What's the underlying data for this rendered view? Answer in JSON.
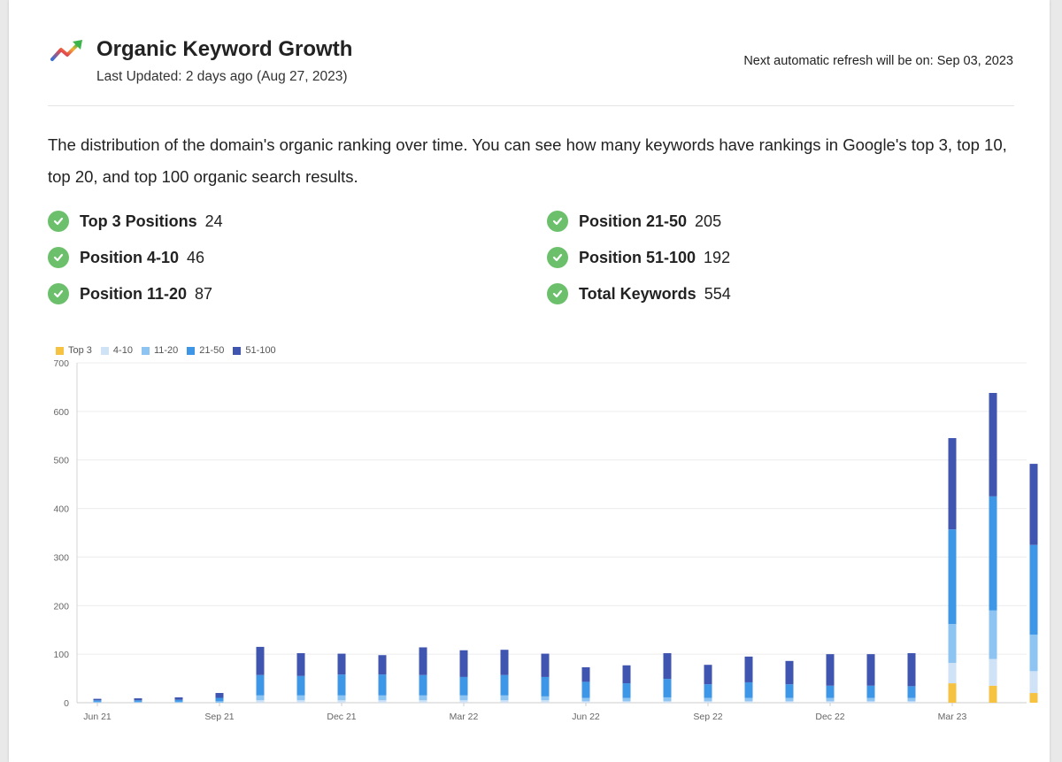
{
  "header": {
    "logo_icon": "trending-up-arrow-icon",
    "title": "Organic Keyword Growth",
    "last_updated": "Last Updated: 2 days ago (Aug 27, 2023)",
    "refresh_text": "Next automatic refresh will be on: Sep 03, 2023"
  },
  "description": "The distribution of the domain's organic ranking over time. You can see how many keywords have rankings in Google's top 3, top 10, top 20, and top 100 organic search results.",
  "stats": [
    {
      "label": "Top 3 Positions",
      "value": "24"
    },
    {
      "label": "Position 4-10",
      "value": "46"
    },
    {
      "label": "Position 11-20",
      "value": "87"
    },
    {
      "label": "Position 21-50",
      "value": "205"
    },
    {
      "label": "Position 51-100",
      "value": "192"
    },
    {
      "label": "Total Keywords",
      "value": "554"
    }
  ],
  "colors": {
    "check": "#6cc06c",
    "top3": "#f5c242",
    "p4_10": "#cfe2f6",
    "p11_20": "#8ec4f2",
    "p21_50": "#3d97e6",
    "p51_100": "#3f55b0"
  },
  "chart_data": {
    "type": "bar",
    "stacked": true,
    "grid": true,
    "legend_position": "top-left",
    "ylim": [
      0,
      700
    ],
    "y_ticks": [
      0,
      100,
      200,
      300,
      400,
      500,
      600,
      700
    ],
    "x_tick_labels": [
      "Jun 21",
      "Sep 21",
      "Dec 21",
      "Mar 22",
      "Jun 22",
      "Sep 22",
      "Dec 22",
      "Mar 23"
    ],
    "categories": [
      "Jun 21",
      "Jul 21",
      "Aug 21",
      "Sep 21",
      "Oct 21",
      "Nov 21",
      "Dec 21",
      "Jan 22",
      "Feb 22",
      "Mar 22",
      "Apr 22",
      "May 22",
      "Jun 22",
      "Jul 22",
      "Aug 22",
      "Sep 22",
      "Oct 22",
      "Nov 22",
      "Dec 22",
      "Jan 23",
      "Feb 23",
      "Mar 23",
      "Apr 23",
      "May 23"
    ],
    "series": [
      {
        "name": "Top 3",
        "color": "#f5c242",
        "values": [
          0,
          0,
          0,
          0,
          0,
          0,
          0,
          0,
          0,
          0,
          0,
          0,
          0,
          0,
          0,
          0,
          0,
          0,
          0,
          0,
          0,
          40,
          35,
          20
        ]
      },
      {
        "name": "4-10",
        "color": "#cfe2f6",
        "values": [
          0,
          0,
          0,
          0,
          5,
          5,
          5,
          5,
          5,
          5,
          5,
          5,
          3,
          3,
          3,
          3,
          3,
          3,
          3,
          3,
          3,
          42,
          55,
          45
        ]
      },
      {
        "name": "11-20",
        "color": "#8ec4f2",
        "values": [
          2,
          2,
          2,
          3,
          10,
          10,
          10,
          10,
          10,
          10,
          10,
          8,
          7,
          7,
          8,
          7,
          7,
          7,
          7,
          7,
          7,
          80,
          100,
          75
        ]
      },
      {
        "name": "21-50",
        "color": "#3d97e6",
        "values": [
          3,
          3,
          4,
          7,
          42,
          40,
          43,
          43,
          42,
          38,
          42,
          40,
          33,
          30,
          38,
          28,
          32,
          28,
          25,
          25,
          24,
          195,
          235,
          185
        ]
      },
      {
        "name": "51-100",
        "color": "#3f55b0",
        "values": [
          3,
          4,
          5,
          10,
          58,
          47,
          43,
          40,
          57,
          55,
          52,
          48,
          30,
          37,
          53,
          40,
          53,
          48,
          65,
          65,
          68,
          188,
          213,
          167
        ]
      }
    ]
  }
}
